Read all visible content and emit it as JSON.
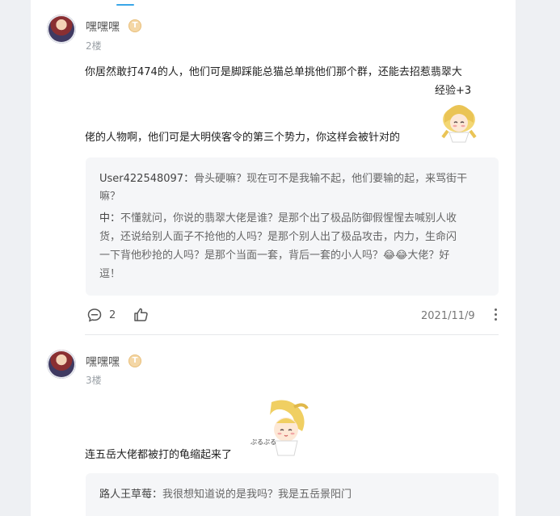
{
  "posts": [
    {
      "username": "嘿嘿嘿",
      "badge": "T",
      "floor": "2楼",
      "content_line1": "你居然敢打474的人，他们可是脚踩能总猫总单挑他们那个群，还能去招惹翡翠大",
      "content_line2": "佬的人物啊，他们可是大明侠客令的第三个势力，你这样会被针对的",
      "sticker_text": "经验+3",
      "quotes": [
        {
          "user": "User422548097",
          "sep": "：",
          "lines": [
            "骨头硬嘛？现在可不是我输不起，他们要输的起，来骂街干",
            "嘛？"
          ]
        },
        {
          "user": "中",
          "sep": "：",
          "lines": [
            "不懂就问，你说的翡翠大佬是谁？是那个出了极品防御假惺惺去喊别人收",
            "货，还说给别人面子不抢他的人吗？是那个别人出了极品攻击，内力，生命闪",
            "一下背他秒抢的人吗？是那个当面一套，背后一套的小人吗？😂😂大佬？好",
            "逗！"
          ]
        }
      ],
      "comment_count": "2",
      "date": "2021/11/9"
    },
    {
      "username": "嘿嘿嘿",
      "badge": "T",
      "floor": "3楼",
      "content_line1": "连五岳大佬都被打的龟缩起来了",
      "sticker_text": "ぷるぷる",
      "quotes": [
        {
          "user": "路人王草莓",
          "sep": "：",
          "lines": [
            "我很想知道说的是我吗？我是五岳景阳门"
          ]
        }
      ]
    }
  ],
  "colors": {
    "page_bg": "#eef0f3",
    "card_bg": "#ffffff",
    "quote_bg": "#f5f6f8",
    "accent": "#3aa6e8"
  },
  "icons": [
    "comment-icon",
    "like-icon",
    "more-icon",
    "avatar",
    "level-badge"
  ]
}
